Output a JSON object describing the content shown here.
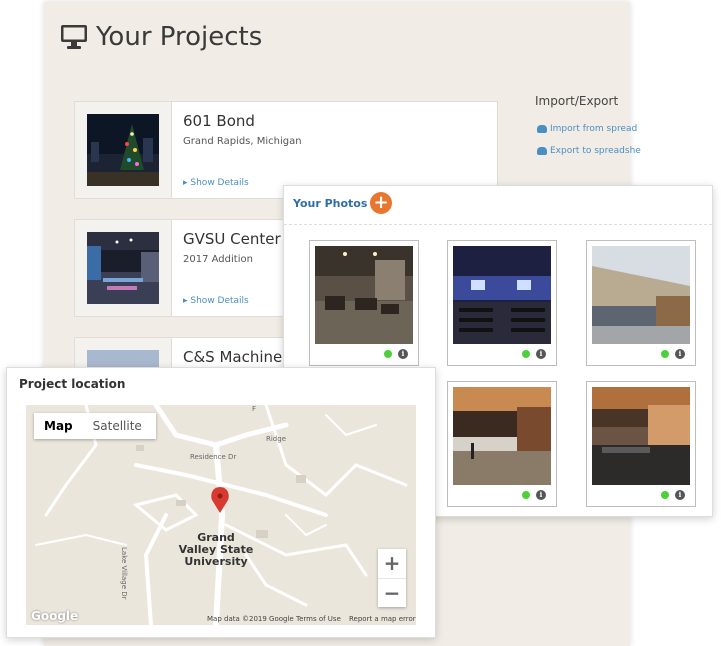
{
  "page": {
    "title": "Your Projects",
    "title_icon": "monitor-icon"
  },
  "projects": [
    {
      "name": "601 Bond",
      "subtitle": "Grand Rapids, Michigan",
      "link": "Show Details"
    },
    {
      "name": "GVSU Center fo",
      "subtitle": "2017 Addition",
      "link": "Show Details"
    },
    {
      "name": "C&S Machine",
      "subtitle": "",
      "link": ""
    }
  ],
  "import_export": {
    "title": "Import/Export",
    "import_label": "Import from spread",
    "export_label": "Export to spreadshe"
  },
  "photos": {
    "title": "Your Photos",
    "add_icon": "plus-icon",
    "status_color": "#4cd03a",
    "count": 6
  },
  "map": {
    "title": "Project location",
    "tabs": [
      "Map",
      "Satellite"
    ],
    "active_tab": "Map",
    "place_line1": "Grand",
    "place_line2": "Valley State",
    "place_line3": "University",
    "road_residence": "Residence Dr",
    "road_lake_village": "Lake Village Dr",
    "road_pierce": "Pierce",
    "road_sylvester": "Sylvester",
    "road_f": "F",
    "road_ridge": "Ridge",
    "zoom_in": "+",
    "zoom_out": "−",
    "logo": "Google",
    "attribution": "Map data ©2019 Google",
    "terms": "Terms of Use",
    "report": "Report a map error"
  },
  "colors": {
    "accent": "#e8762e",
    "link": "#4a8fc2",
    "photos_title": "#2f6ea8",
    "marker": "#d93a2f"
  }
}
